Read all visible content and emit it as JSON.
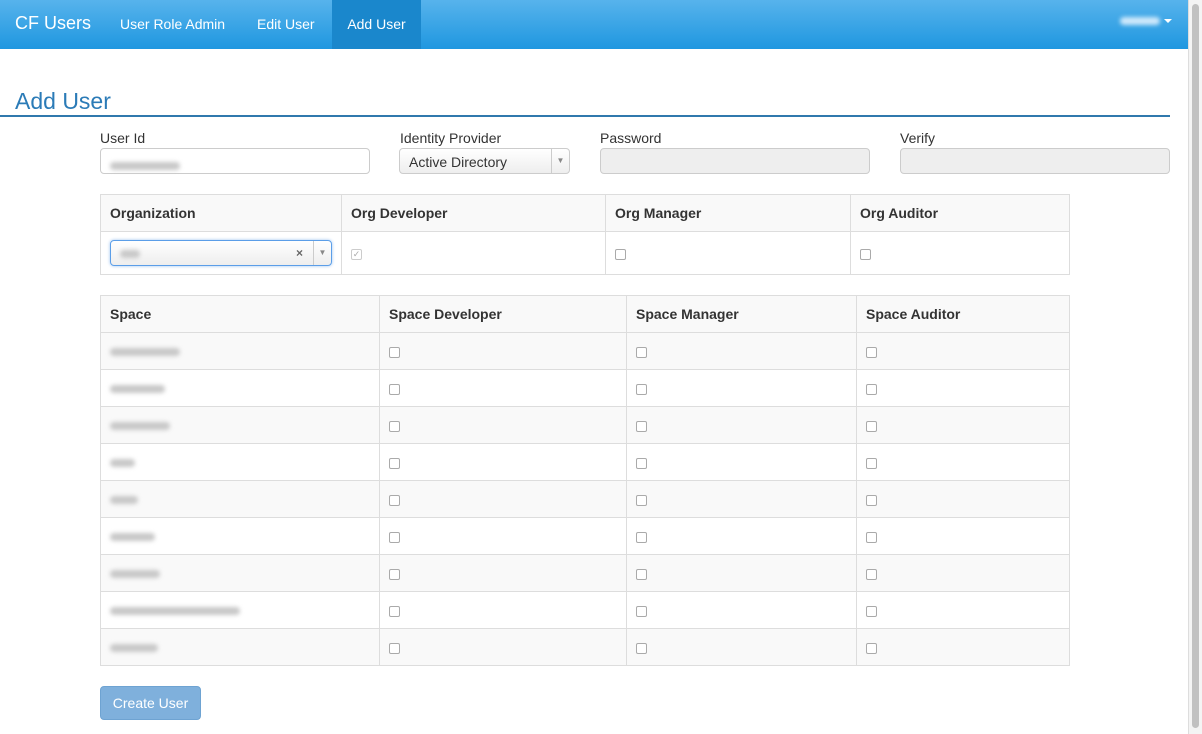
{
  "nav": {
    "brand": "CF Users",
    "items": [
      {
        "label": "User Role Admin"
      },
      {
        "label": "Edit User"
      },
      {
        "label": "Add User",
        "active": true
      }
    ]
  },
  "page": {
    "title": "Add User"
  },
  "form": {
    "user_id_label": "User Id",
    "idp_label": "Identity Provider",
    "idp_value": "Active Directory",
    "password_label": "Password",
    "verify_label": "Verify"
  },
  "org_table": {
    "headers": [
      "Organization",
      "Org Developer",
      "Org Manager",
      "Org Auditor"
    ],
    "org_developer_checked": true,
    "org_manager_checked": false,
    "org_auditor_checked": false
  },
  "space_table": {
    "headers": [
      "Space",
      "Space Developer",
      "Space Manager",
      "Space Auditor"
    ],
    "row_count_note": null
  },
  "buttons": {
    "create": "Create User"
  },
  "colors": {
    "nav": "#1f97e0",
    "title": "#2b7bb7",
    "button": "#7fb0dc"
  }
}
